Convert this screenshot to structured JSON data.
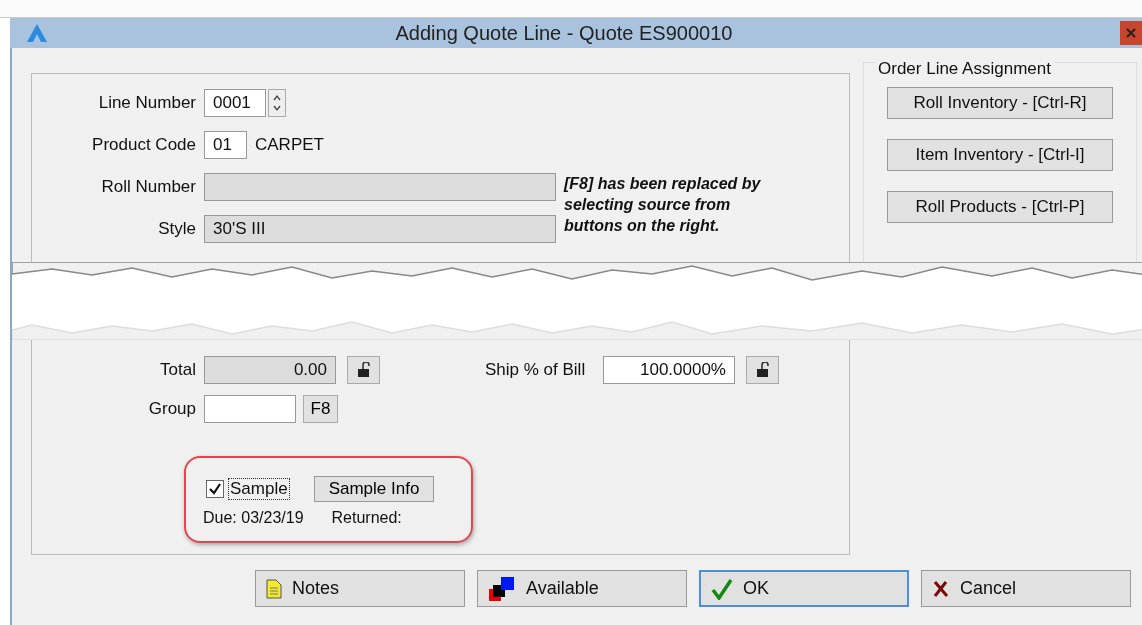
{
  "window": {
    "title": "Adding Quote Line - Quote ES900010"
  },
  "fields": [
    {
      "label": "Line Number",
      "value": "0001",
      "kind": "spinner"
    },
    {
      "label": "Product Code",
      "value": "01",
      "kind": "code",
      "description": "CARPET"
    },
    {
      "label": "Roll Number",
      "kind": "readonly"
    },
    {
      "label": "Style",
      "value": "30'S III",
      "kind": "readonly"
    }
  ],
  "note": "[F8] has been replaced by selecting source from buttons on the right.",
  "order_line_assignment": {
    "title": "Order Line Assignment",
    "buttons": [
      "Roll Inventory - [Ctrl-R]",
      "Item Inventory - [Ctrl-I]",
      "Roll Products - [Ctrl-P]"
    ]
  },
  "total": {
    "label": "Total",
    "value": "0.00"
  },
  "ship_percent": {
    "label": "Ship % of Bill",
    "value": "100.0000%"
  },
  "group": {
    "label": "Group",
    "button": "F8"
  },
  "sample": {
    "label": "Sample",
    "checked": true,
    "info_button": "Sample Info",
    "due": "Due: 03/23/19",
    "returned": "Returned:"
  },
  "buttons": [
    {
      "label": "Notes",
      "kind": "notes",
      "focused": false
    },
    {
      "label": "Available",
      "kind": "available",
      "focused": false
    },
    {
      "label": "OK",
      "kind": "ok",
      "focused": true
    },
    {
      "label": "Cancel",
      "kind": "cancel",
      "focused": false
    }
  ]
}
